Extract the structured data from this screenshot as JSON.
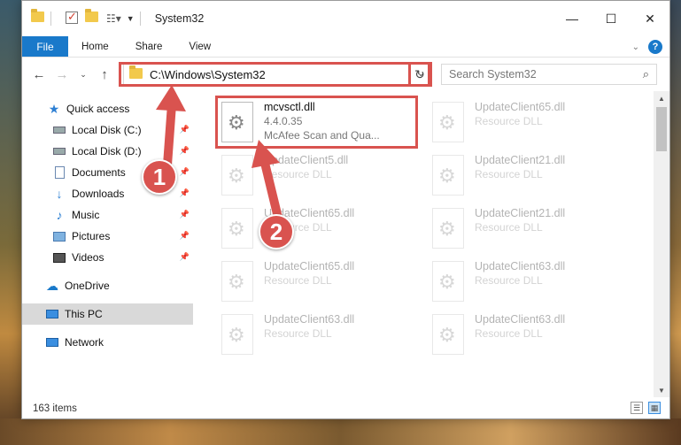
{
  "window": {
    "title": "System32"
  },
  "ribbon": {
    "file": "File",
    "tabs": [
      "Home",
      "Share",
      "View"
    ],
    "help": "?"
  },
  "address": {
    "path": "C:\\Windows\\System32"
  },
  "search": {
    "placeholder": "Search System32"
  },
  "nav": {
    "items": [
      {
        "label": "Quick access",
        "icon": "star-icon",
        "pinned": false
      },
      {
        "label": "Local Disk (C:)",
        "icon": "drive-icon",
        "pinned": true
      },
      {
        "label": "Local Disk (D:)",
        "icon": "drive-icon",
        "pinned": true
      },
      {
        "label": "Documents",
        "icon": "documents-icon",
        "pinned": true
      },
      {
        "label": "Downloads",
        "icon": "download-icon",
        "pinned": true
      },
      {
        "label": "Music",
        "icon": "music-icon",
        "pinned": true
      },
      {
        "label": "Pictures",
        "icon": "pictures-icon",
        "pinned": true
      },
      {
        "label": "Videos",
        "icon": "videos-icon",
        "pinned": true
      },
      {
        "label": "OneDrive",
        "icon": "cloud-icon",
        "pinned": false
      },
      {
        "label": "This PC",
        "icon": "computer-icon",
        "pinned": false
      },
      {
        "label": "Network",
        "icon": "network-icon",
        "pinned": false
      }
    ]
  },
  "files": [
    {
      "name": "mcvsctl.dll",
      "line2": "4.4.0.35",
      "line3": "McAfee Scan and Qua...",
      "faded": false
    },
    {
      "name": "UpdateClient65.dll",
      "line2": "Resource DLL",
      "faded": true
    },
    {
      "name": "UpdateClient5.dll",
      "line2": "Resource DLL",
      "faded": true
    },
    {
      "name": "UpdateClient21.dll",
      "line2": "Resource DLL",
      "faded": true
    },
    {
      "name": "UpdateClient65.dll",
      "line2": "Resource DLL",
      "faded": true
    },
    {
      "name": "UpdateClient21.dll",
      "line2": "Resource DLL",
      "faded": true
    },
    {
      "name": "UpdateClient65.dll",
      "line2": "Resource DLL",
      "faded": true
    },
    {
      "name": "UpdateClient63.dll",
      "line2": "Resource DLL",
      "faded": true
    },
    {
      "name": "UpdateClient63.dll",
      "line2": "Resource DLL",
      "faded": true
    },
    {
      "name": "UpdateClient63.dll",
      "line2": "Resource DLL",
      "faded": true
    }
  ],
  "status": {
    "count": "163 items"
  },
  "callouts": [
    "1",
    "2"
  ],
  "colors": {
    "accent": "#1979ca",
    "highlight": "#d9534f",
    "selected": "#d9d9d9"
  }
}
